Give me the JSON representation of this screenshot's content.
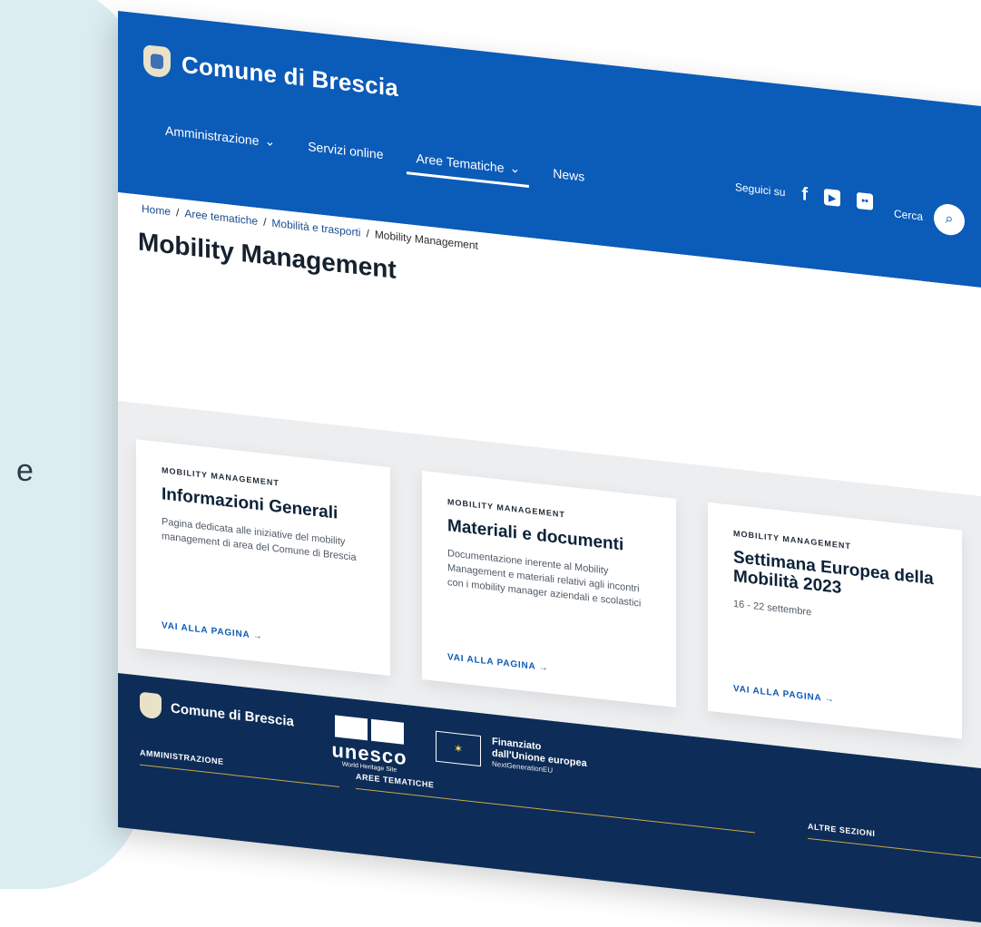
{
  "background": {
    "panel_letter": "e"
  },
  "header": {
    "brand": "Comune di Brescia",
    "nav": [
      {
        "label": "Amministrazione",
        "chevron": true,
        "active": false
      },
      {
        "label": "Servizi online",
        "chevron": false,
        "active": false
      },
      {
        "label": "Aree Tematiche",
        "chevron": true,
        "active": true
      },
      {
        "label": "News",
        "chevron": false,
        "active": false
      }
    ],
    "social_label": "Seguici su",
    "search_label": "Cerca"
  },
  "breadcrumb": [
    "Home",
    "Aree tematiche",
    "Mobilità e trasporti",
    "Mobility Management"
  ],
  "page_title": "Mobility Management",
  "cards": [
    {
      "kicker": "MOBILITY MANAGEMENT",
      "title": "Informazioni Generali",
      "description": "Pagina dedicata alle iniziative del mobility management di area del Comune di Brescia",
      "link": "VAI ALLA PAGINA"
    },
    {
      "kicker": "MOBILITY MANAGEMENT",
      "title": "Materiali e documenti",
      "description": "Documentazione inerente al Mobility Management e materiali relativi agli incontri con i mobility manager aziendali e scolastici",
      "link": "VAI ALLA PAGINA"
    },
    {
      "kicker": "MOBILITY MANAGEMENT",
      "title": "Settimana Europea della Mobilità 2023",
      "description": "16 - 22 settembre",
      "link": "VAI ALLA PAGINA"
    }
  ],
  "footer": {
    "brand": "Comune di Brescia",
    "unesco_word": "unesco",
    "unesco_sub": "World Heritage Site",
    "eu_line1": "Finanziato",
    "eu_line2": "dall'Unione europea",
    "eu_line3": "NextGenerationEU",
    "sections": [
      "AMMINISTRAZIONE",
      "AREE TEMATICHE",
      "ALTRE SEZIONI"
    ]
  },
  "colors": {
    "primary": "#0b5bb8",
    "footer": "#0d2c57",
    "panel": "#dcedf1",
    "cards_bg": "#eceef0"
  }
}
